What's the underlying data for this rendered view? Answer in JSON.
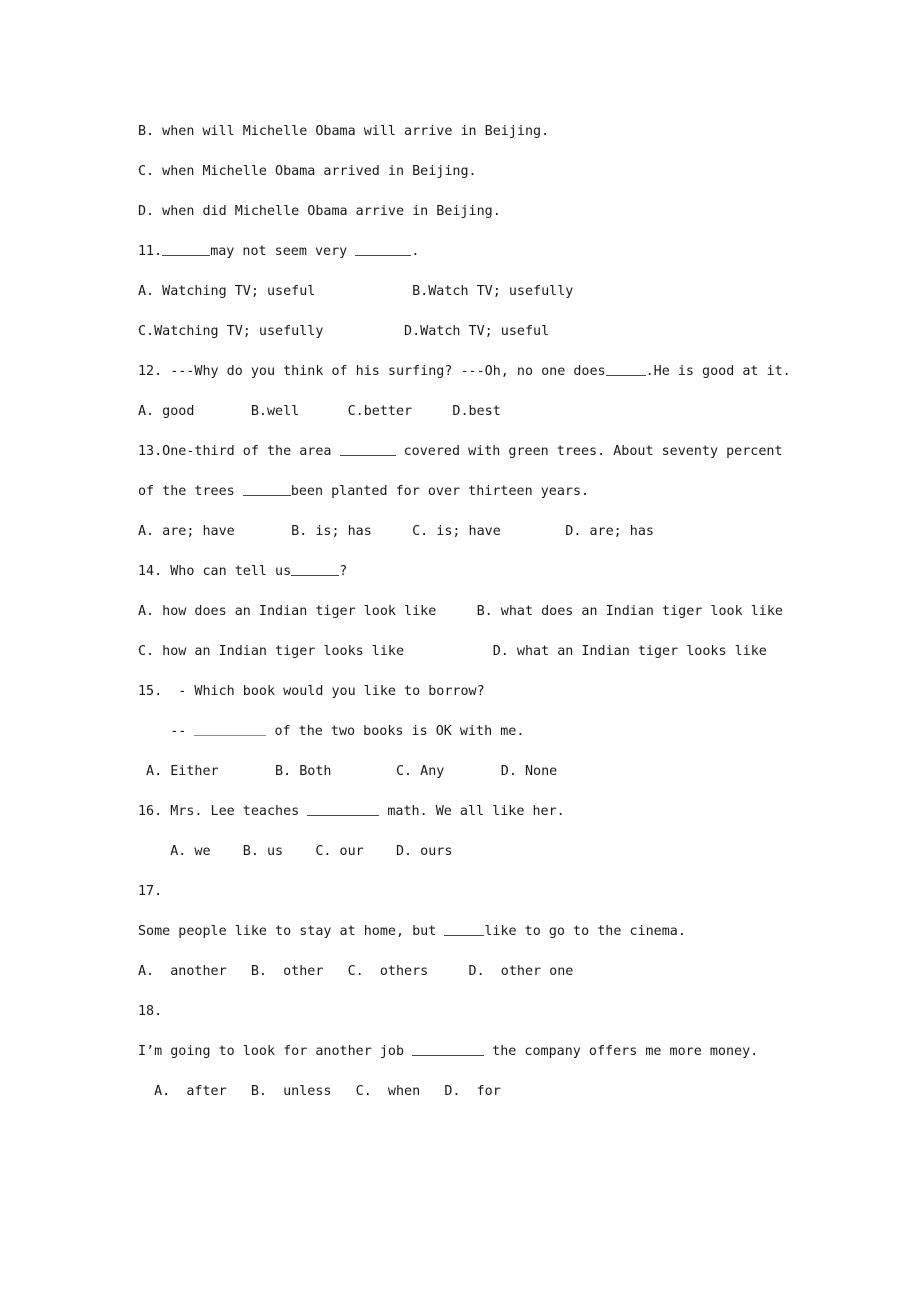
{
  "document": {
    "type": "english-grammar-multiple-choice-worksheet",
    "language": "en",
    "text_color": "#1a1a1a",
    "background_color": "#ffffff",
    "rule_color": "#4a4a4a"
  },
  "lines": {
    "q10_option_b": "B. when will Michelle Obama will arrive in Beijing.",
    "q10_option_c": "C. when Michelle Obama arrived in Beijing.",
    "q10_option_d": "D. when did Michelle Obama arrive in Beijing.",
    "q11_number": "11.",
    "q11_stem_after_blank1": "may not seem very ",
    "q11_stem_end": ".",
    "q11_options_row1": "A. Watching TV; useful            B.Watch TV; usefully",
    "q11_options_row2": "C.Watching TV; usefully          D.Watch TV; useful",
    "q12_stem_pre": "12. ---Why do you think of his surfing? ---Oh, no one does",
    "q12_stem_post": ".He is good at it.",
    "q12_options": "A. good       B.well      C.better     D.best",
    "q13_stem_pre": "13.One-third of the area ",
    "q13_stem_mid": " covered with green trees. About seventy percent",
    "q13_stem_line2_pre": "of the trees ",
    "q13_stem_line2_post": "been planted for over thirteen years.",
    "q13_options": "A. are; have       B. is; has     C. is; have        D. are; has",
    "q14_stem_pre": "14. Who can tell us",
    "q14_stem_post": "?",
    "q14_options_row1": "A. how does an Indian tiger look like     B. what does an Indian tiger look like",
    "q14_options_row2": "C. how an Indian tiger looks like           D. what an Indian tiger looks like",
    "q15_stem_line1": "15.  - Which book would you like to borrow?",
    "q15_stem_line2_pre": "    -- ",
    "q15_stem_line2_post": " of the two books is OK with me.",
    "q15_options": " A. Either       B. Both        C. Any       D. None",
    "q16_stem_pre": "16. Mrs. Lee teaches ",
    "q16_stem_post": " math. We all like her.",
    "q16_options": "    A. we    B. us    C. our    D. ours",
    "q17_number": "17.",
    "q17_stem_pre": "Some people like to stay at home, but ",
    "q17_stem_post": "like to go to the cinema.",
    "q17_options": "A.  another   B.  other   C.  others     D.  other one",
    "q18_number": "18.",
    "q18_stem_pre": "I’m going to look for another job ",
    "q18_stem_post": " the company offers me more money.",
    "q18_options": "  A.  after   B.  unless   C.  when   D.  for"
  },
  "blanks": {
    "q11_blank1_label": "answer-blank",
    "q11_blank2_label": "answer-blank",
    "q12_blank_label": "answer-blank",
    "q13_blank1_label": "answer-blank",
    "q13_blank2_label": "answer-blank",
    "q14_blank_label": "answer-blank",
    "q15_blank_label": "answer-blank",
    "q16_blank_label": "answer-blank",
    "q17_blank_label": "answer-blank",
    "q18_blank_label": "answer-blank"
  }
}
